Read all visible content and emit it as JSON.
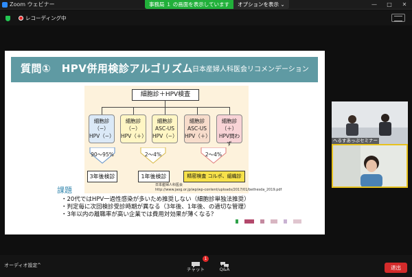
{
  "window": {
    "title": "Zoom ウェビナー",
    "controls": [
      "—",
      "□",
      "✕"
    ]
  },
  "share_banner": {
    "text": "事務局 １ の画面を表示しています",
    "options": "オプションを表示 ⌄"
  },
  "recording": {
    "label": "レコーディング中"
  },
  "slide": {
    "title": "質問①　HPV併用検診アルゴリズム",
    "title_sub": "日本産婦人科医会リコメンデーション",
    "root": "細胞診＋HPV検査",
    "categories": [
      "細胞診（−）\nHPV（−）",
      "細胞診（−）\nHPV（＋）",
      "細胞診\nASC-US\nHPV（−）",
      "細胞診\nASC-US\nHPV（＋）",
      "細胞診（＋）\nHPV問わず"
    ],
    "percentages": [
      "90～95%",
      "2～4%",
      "2～4%"
    ],
    "results": [
      "3年後検診",
      "1年後検診",
      "精密検査 コルポ、組織診"
    ],
    "source_org": "日本産婦人科医会",
    "source_url": "http://www.jaog.or.jp/wp/wp-content/uploads/2017/01/bethesda_2019.pdf",
    "topic_label": "課題",
    "bullets": [
      "・20代ではHPV一過性感染が多いため推奨しない（細胞診単独法推奨）",
      "・判定毎に次回検診受診時期が異なる（3年後、1年後、の適切な管理）",
      "・3年以内の離職率が高い企業では費用対効果が薄くなる？"
    ]
  },
  "videos": [
    {
      "name": "へるすあっぷセミナー"
    },
    {
      "name": ""
    }
  ],
  "bottombar": {
    "audio": "オーディオ設定",
    "chat": "チャット",
    "chat_badge": "1",
    "qa": "Q&A",
    "exit": "退出"
  },
  "colors": {
    "accent_green": "#21b03a",
    "title_teal": "#5f9aa3",
    "exit_red": "#d42b2b",
    "speaker_border": "#e7c21c"
  }
}
